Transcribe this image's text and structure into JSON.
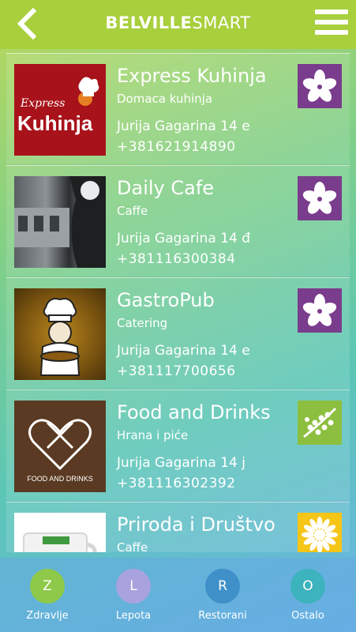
{
  "header": {
    "brand_bold": "BELVILLE",
    "brand_light": "SMART"
  },
  "venues": [
    {
      "name": "Express Kuhinja",
      "category": "Domaca kuhinja",
      "address": "Jurija Gagarina 14 e",
      "phone": "+381621914890",
      "logo_text_top": "Express",
      "logo_text_bottom": "Kuhinja",
      "category_icon": "flower-icon",
      "icon_color": "#7a3c8c"
    },
    {
      "name": "Daily Cafe",
      "category": "Caffe",
      "address": "Jurija Gagarina 14 đ",
      "phone": "+381116300384",
      "category_icon": "flower-icon",
      "icon_color": "#7a3c8c"
    },
    {
      "name": "GastroPub",
      "category": "Catering",
      "address": "Jurija Gagarina 14 e",
      "phone": "+381117700656",
      "category_icon": "flower-icon",
      "icon_color": "#7a3c8c"
    },
    {
      "name": "Food and Drinks",
      "category": "Hrana i piće",
      "address": "Jurija Gagarina 14 j",
      "phone": "+381116302392",
      "logo_text": "FOOD AND DRINKS",
      "category_icon": "branch-icon",
      "icon_color": "#8cbf3f"
    },
    {
      "name": "Priroda i Društvo",
      "category": "Caffe",
      "address": "",
      "phone": "",
      "category_icon": "sun-icon",
      "icon_color": "#f5c518"
    }
  ],
  "tabs": [
    {
      "letter": "Z",
      "label": "Zdravlje",
      "color": "#8fc94a"
    },
    {
      "letter": "L",
      "label": "Lepota",
      "color": "#a8a3de"
    },
    {
      "letter": "R",
      "label": "Restorani",
      "color": "#3f8fc9"
    },
    {
      "letter": "O",
      "label": "Ostalo",
      "color": "#3cb3bd"
    }
  ]
}
